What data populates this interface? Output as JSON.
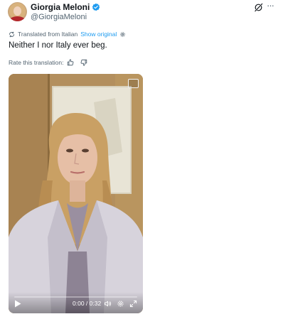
{
  "author": {
    "display_name": "Giorgia Meloni",
    "handle": "@GiorgiaMeloni"
  },
  "icons": {
    "verified": "verified-badge-icon",
    "grok": "grok-icon",
    "more": "more-icon",
    "translate": "translate-icon",
    "settings": "gear-icon",
    "thumbs_up": "thumbs-up-icon",
    "thumbs_down": "thumbs-down-icon",
    "play": "play-icon",
    "volume": "volume-icon",
    "fullscreen": "fullscreen-icon"
  },
  "translation": {
    "label": "Translated from Italian",
    "show_original": "Show original",
    "rate_label": "Rate this translation:"
  },
  "tweet": {
    "text": "Neither I nor Italy ever beg."
  },
  "video": {
    "time": "0:00 / 0:32",
    "progress": 0
  },
  "colors": {
    "accent": "#1d9bf0",
    "text_primary": "#0f1419",
    "text_secondary": "#536471"
  }
}
